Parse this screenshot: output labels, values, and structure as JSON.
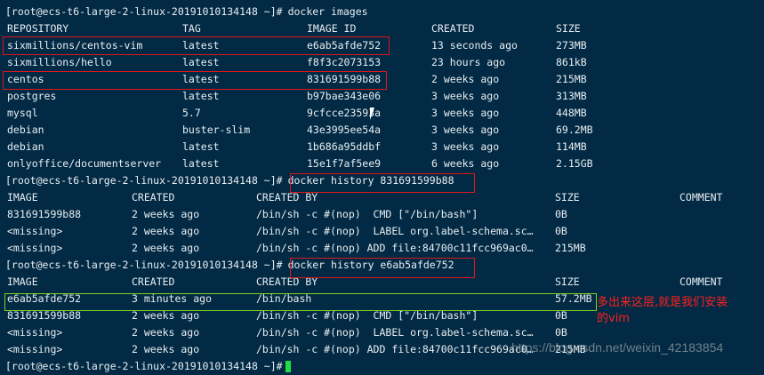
{
  "prompt": "[root@ecs-t6-large-2-linux-20191010134148 ~]#",
  "cmd_images": "docker images",
  "images": {
    "headers": [
      "REPOSITORY",
      "TAG",
      "IMAGE ID",
      "CREATED",
      "SIZE"
    ],
    "rows": [
      [
        "sixmillions/centos-vim",
        "latest",
        "e6ab5afde752",
        "13 seconds ago",
        "273MB"
      ],
      [
        "sixmillions/hello",
        "latest",
        "f8f3c2073153",
        "23 hours ago",
        "861kB"
      ],
      [
        "centos",
        "latest",
        "831691599b88",
        "2 weeks ago",
        "215MB"
      ],
      [
        "postgres",
        "latest",
        "b97bae343e06",
        "3 weeks ago",
        "313MB"
      ],
      [
        "mysql",
        "5.7",
        "9cfcce23593a",
        "3 weeks ago",
        "448MB"
      ],
      [
        "debian",
        "buster-slim",
        "43e3995ee54a",
        "3 weeks ago",
        "69.2MB"
      ],
      [
        "debian",
        "latest",
        "1b686a95ddbf",
        "3 weeks ago",
        "114MB"
      ],
      [
        "onlyoffice/documentserver",
        "latest",
        "15e1f7af5ee9",
        "6 weeks ago",
        "2.15GB"
      ]
    ]
  },
  "cmd_history1": "docker history 831691599b88",
  "history_headers": [
    "IMAGE",
    "CREATED",
    "CREATED BY",
    "SIZE",
    "COMMENT"
  ],
  "history1": [
    [
      "831691599b88",
      "2 weeks ago",
      "/bin/sh -c #(nop)  CMD [\"/bin/bash\"]",
      "0B"
    ],
    [
      "<missing>",
      "2 weeks ago",
      "/bin/sh -c #(nop)  LABEL org.label-schema.sc…",
      "0B"
    ],
    [
      "<missing>",
      "2 weeks ago",
      "/bin/sh -c #(nop) ADD file:84700c11fcc969ac0…",
      "215MB"
    ]
  ],
  "cmd_history2": "docker history e6ab5afde752",
  "history2": [
    [
      "e6ab5afde752",
      "3 minutes ago",
      "/bin/bash",
      "57.2MB"
    ],
    [
      "831691599b88",
      "2 weeks ago",
      "/bin/sh -c #(nop)  CMD [\"/bin/bash\"]",
      "0B"
    ],
    [
      "<missing>",
      "2 weeks ago",
      "/bin/sh -c #(nop)  LABEL org.label-schema.sc…",
      "0B"
    ],
    [
      "<missing>",
      "2 weeks ago",
      "/bin/sh -c #(nop) ADD file:84700c11fcc969ac0…",
      "215MB"
    ]
  ],
  "annotation": [
    "多出来这层,就是我们安装",
    "的vim"
  ],
  "watermark": "https://blog.csdn.net/weixin_42183854",
  "colors": {
    "background": "#022a44",
    "highlight_red": "#e0161a",
    "highlight_green": "#7cd21e",
    "annotation": "#ff2020"
  }
}
